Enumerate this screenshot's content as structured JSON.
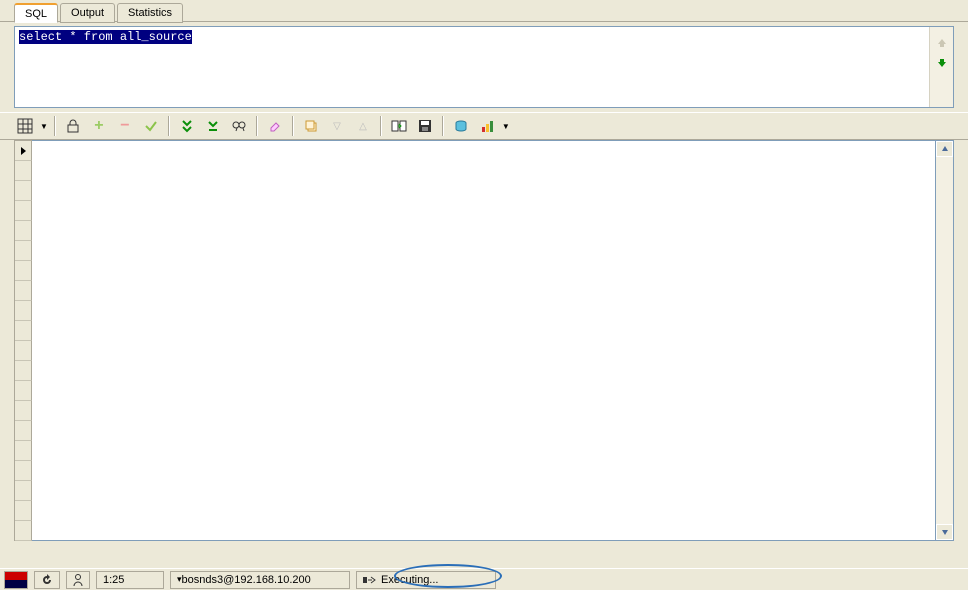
{
  "tabs": {
    "sql": "SQL",
    "output": "Output",
    "statistics": "Statistics"
  },
  "sql_query": "select * from all_source",
  "toolbar": {
    "grid_btn": "grid",
    "lock_btn": "lock",
    "add_btn": "add",
    "remove_btn": "remove",
    "check_btn": "check",
    "run_all": "run-all",
    "run_step": "run-step",
    "find": "find",
    "erase": "erase",
    "copy": "copy",
    "down": "down",
    "up": "up",
    "export": "export",
    "save": "save",
    "db": "db",
    "chart": "chart"
  },
  "status": {
    "pos": "1:25",
    "connection": "bosnds3@192.168.10.200",
    "exec": "Executing...",
    "refresh_icon": "refresh",
    "user_icon": "user",
    "run_icon": "executing"
  },
  "colors": {
    "accent": "#f0a030",
    "sel_bg": "#000080",
    "border": "#aca899"
  }
}
